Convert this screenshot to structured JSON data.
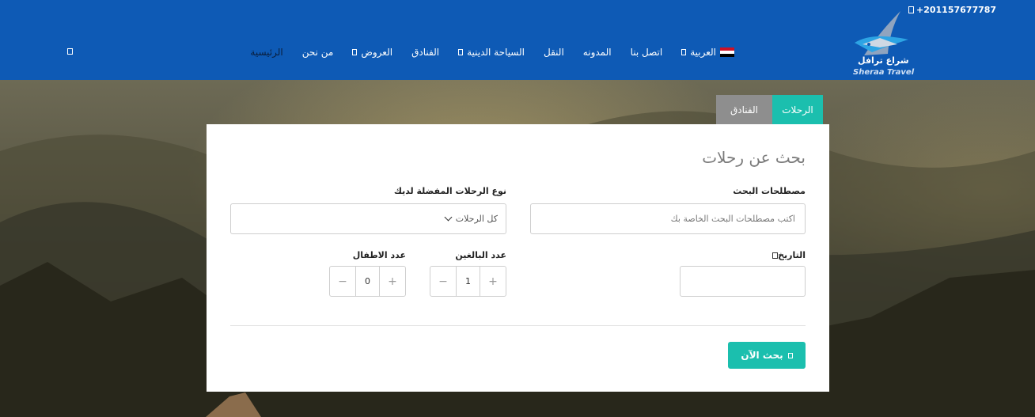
{
  "header": {
    "phone": "+201157677787",
    "logo_ar": "شراع ترافل",
    "logo_en": "Sheraa Travel",
    "brand_color": "#0e5ab5",
    "nav": [
      {
        "label": "الرئيسية",
        "has_caret": false,
        "active": true
      },
      {
        "label": "من نحن",
        "has_caret": false
      },
      {
        "label": "العروض",
        "has_caret": true
      },
      {
        "label": "الفنادق",
        "has_caret": false
      },
      {
        "label": "السياحة الدينية",
        "has_caret": true
      },
      {
        "label": "النقل",
        "has_caret": false
      },
      {
        "label": "المدونه",
        "has_caret": false
      },
      {
        "label": "اتصل بنا",
        "has_caret": false
      },
      {
        "label": "العربية",
        "has_caret": true,
        "flag": "egypt"
      }
    ]
  },
  "tabs": {
    "trips": "الرحلات",
    "hotels": "الفنادق",
    "accent": "#1bbfae"
  },
  "form": {
    "title": "بحث عن رحلات",
    "search_terms_label": "مصطلحات البحث",
    "search_terms_placeholder": "اكتب مصطلحات البحث الخاصة بك",
    "trip_type_label": "نوع الرحلات المفضلة لديك",
    "trip_type_value": "كل الرحلات",
    "date_label": "التاريخ",
    "adults_label": "عدد البالغين",
    "adults_value": "1",
    "children_label": "عدد الاطفال",
    "children_value": "0",
    "search_button": "بحث الآن"
  }
}
